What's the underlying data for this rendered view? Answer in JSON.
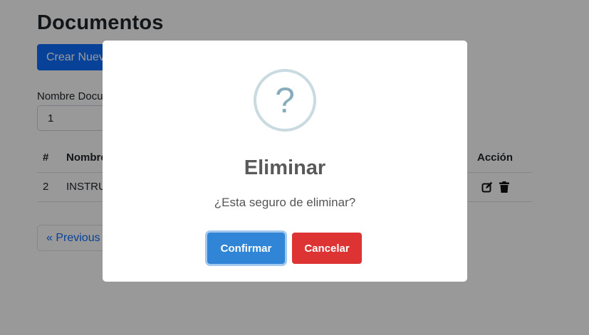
{
  "page": {
    "title": "Documentos",
    "new_button_label": "Crear Nuevo",
    "filter_label": "Nombre Documento",
    "filter_value": "1"
  },
  "table": {
    "headers": {
      "num": "#",
      "name": "Nombre",
      "action": "Acción"
    },
    "rows": [
      {
        "num": "2",
        "name": "INSTRUCTIVO",
        "actions": [
          "edit-icon",
          "trash-icon"
        ]
      }
    ]
  },
  "pagination": {
    "previous_label": "« Previous"
  },
  "modal": {
    "icon": "question-icon",
    "icon_glyph": "?",
    "title": "Eliminar",
    "text": "¿Esta seguro de eliminar?",
    "confirm_label": "Confirmar",
    "cancel_label": "Cancelar"
  },
  "colors": {
    "primary": "#0d6efd",
    "confirm": "#3085d6",
    "cancel": "#dd3333",
    "overlay": "rgba(0,0,0,0.4)"
  }
}
